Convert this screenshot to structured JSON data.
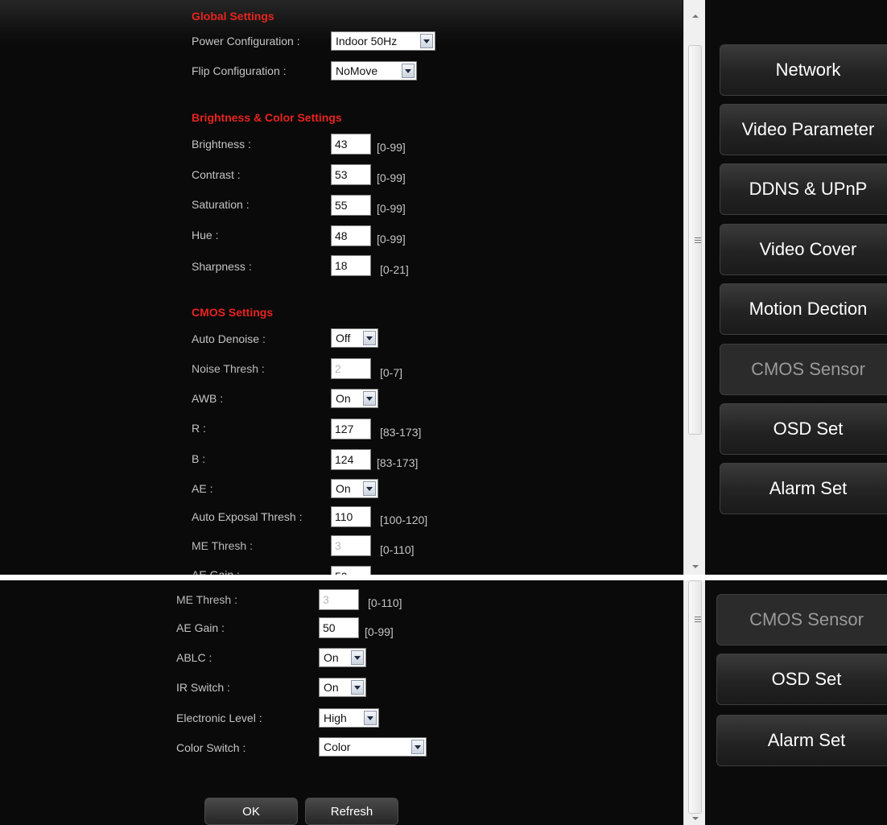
{
  "global_settings": {
    "heading": "Global Settings",
    "power_label": "Power Configuration :",
    "power_value": "Indoor 50Hz",
    "flip_label": "Flip Configuration :",
    "flip_value": "NoMove"
  },
  "brightness_color": {
    "heading": "Brightness & Color Settings",
    "brightness": {
      "label": "Brightness :",
      "value": "43",
      "range": "[0-99]"
    },
    "contrast": {
      "label": "Contrast :",
      "value": "53",
      "range": "[0-99]"
    },
    "saturation": {
      "label": "Saturation :",
      "value": "55",
      "range": "[0-99]"
    },
    "hue": {
      "label": "Hue :",
      "value": "48",
      "range": "[0-99]"
    },
    "sharpness": {
      "label": "Sharpness :",
      "value": "18",
      "range": "[0-21]"
    }
  },
  "cmos": {
    "heading": "CMOS Settings",
    "auto_denoise": {
      "label": "Auto Denoise :",
      "value": "Off"
    },
    "noise_thresh": {
      "label": "Noise Thresh :",
      "value": "2",
      "range": "[0-7]"
    },
    "awb": {
      "label": "AWB :",
      "value": "On"
    },
    "r": {
      "label": "R :",
      "value": "127",
      "range": "[83-173]"
    },
    "b": {
      "label": "B :",
      "value": "124",
      "range": "[83-173]"
    },
    "ae": {
      "label": "AE :",
      "value": "On"
    },
    "auto_exposal_thresh": {
      "label": "Auto Exposal Thresh :",
      "value": "110",
      "range": "[100-120]"
    },
    "me_thresh": {
      "label": "ME Thresh :",
      "value": "3",
      "range": "[0-110]"
    },
    "ae_gain": {
      "label": "AE Gain :",
      "value": "50",
      "range": "[0-99]"
    },
    "ablc": {
      "label": "ABLC :",
      "value": "On"
    },
    "ir_switch": {
      "label": "IR Switch :",
      "value": "On"
    },
    "electronic_level": {
      "label": "Electronic Level :",
      "value": "High"
    },
    "color_switch": {
      "label": "Color Switch :",
      "value": "Color"
    }
  },
  "actions": {
    "ok": "OK",
    "refresh": "Refresh"
  },
  "sidebar": {
    "network": "Network",
    "video_parameter": "Video Parameter",
    "ddns_upnp": "DDNS & UPnP",
    "video_cover": "Video Cover",
    "motion_detection": "Motion Dection",
    "cmos_sensor": "CMOS Sensor",
    "osd_set": "OSD Set",
    "alarm_set": "Alarm Set"
  },
  "colors": {
    "section_heading": "#e8231f",
    "background": "#0a0a0a",
    "active_nav_text": "#9a9a9a"
  }
}
